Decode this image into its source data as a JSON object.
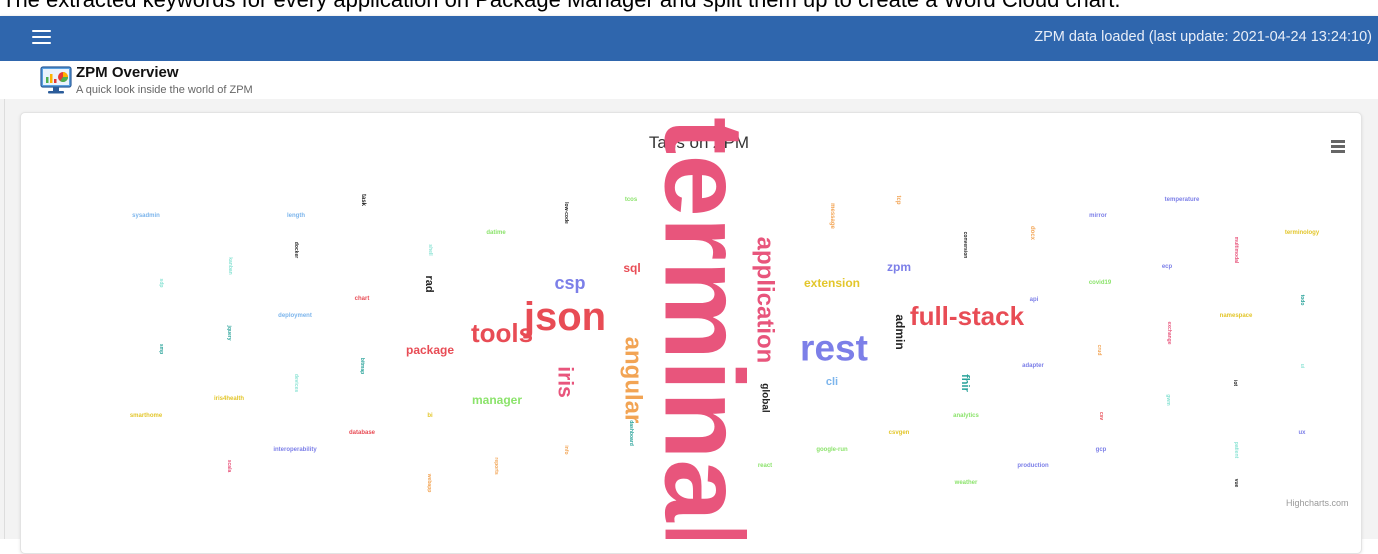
{
  "caption": "The extracted keywords for every application on Package Manager and split them up to create a Word Cloud chart.",
  "header": {
    "status": "ZPM data loaded (last update: 2021-04-24 13:24:10)"
  },
  "page": {
    "title": "ZPM Overview",
    "subtitle": "A quick look inside the world of ZPM"
  },
  "chart_data": {
    "type": "wordcloud",
    "title": "Tags on ZPM",
    "credits": "Highcharts.com",
    "words": [
      {
        "text": "terminal",
        "color": "#e8557c"
      },
      {
        "text": "json",
        "color": "#e84c55"
      },
      {
        "text": "rest",
        "color": "#7c7fe8"
      },
      {
        "text": "application",
        "color": "#e8557c"
      },
      {
        "text": "full-stack",
        "color": "#e84c55"
      },
      {
        "text": "angular",
        "color": "#f2a454"
      },
      {
        "text": "tools",
        "color": "#e84c55"
      },
      {
        "text": "iris",
        "color": "#e8557c"
      },
      {
        "text": "csp",
        "color": "#7c7fe8"
      },
      {
        "text": "extension",
        "color": "#e3c62b"
      },
      {
        "text": "sql",
        "color": "#e84c55"
      },
      {
        "text": "manager",
        "color": "#8be36b"
      },
      {
        "text": "package",
        "color": "#e84c55"
      },
      {
        "text": "zpm",
        "color": "#7c7fe8"
      },
      {
        "text": "admin",
        "color": "#222222"
      },
      {
        "text": "global",
        "color": "#222222"
      },
      {
        "text": "fhir",
        "color": "#2aa39a"
      },
      {
        "text": "rad",
        "color": "#222222"
      },
      {
        "text": "cli",
        "color": "#7cb5ec"
      },
      {
        "text": "sysadmin",
        "color": "#7cb5ec"
      },
      {
        "text": "length",
        "color": "#7cb5ec"
      },
      {
        "text": "task",
        "color": "#222222"
      },
      {
        "text": "low-code",
        "color": "#222222"
      },
      {
        "text": "tcos",
        "color": "#8be36b"
      },
      {
        "text": "datime",
        "color": "#8be36b"
      },
      {
        "text": "message",
        "color": "#f2a454"
      },
      {
        "text": "tcp",
        "color": "#f2a454"
      },
      {
        "text": "conversion",
        "color": "#222222"
      },
      {
        "text": "temperature",
        "color": "#7c7fe8"
      },
      {
        "text": "mirror",
        "color": "#7c7fe8"
      },
      {
        "text": "terminology",
        "color": "#e3c62b"
      },
      {
        "text": "docker",
        "color": "#222222"
      },
      {
        "text": "shell",
        "color": "#8be3d4"
      },
      {
        "text": "kanban",
        "color": "#8be3d4"
      },
      {
        "text": "sdp",
        "color": "#8be3d4"
      },
      {
        "text": "chart",
        "color": "#e84c55"
      },
      {
        "text": "deployment",
        "color": "#7cb5ec"
      },
      {
        "text": "jquery",
        "color": "#2aa39a"
      },
      {
        "text": "smp",
        "color": "#2aa39a"
      },
      {
        "text": "bitmap",
        "color": "#2aa39a"
      },
      {
        "text": "devices",
        "color": "#8be3d4"
      },
      {
        "text": "iris4health",
        "color": "#e3c62b"
      },
      {
        "text": "smarthome",
        "color": "#e3c62b"
      },
      {
        "text": "bi",
        "color": "#e3c62b"
      },
      {
        "text": "database",
        "color": "#e84c55"
      },
      {
        "text": "interoperability",
        "color": "#7c7fe8"
      },
      {
        "text": "scala",
        "color": "#e8557c"
      },
      {
        "text": "webapp",
        "color": "#f2a454"
      },
      {
        "text": "reports",
        "color": "#f2a454"
      },
      {
        "text": "info",
        "color": "#f2a454"
      },
      {
        "text": "dashboard",
        "color": "#2aa39a"
      },
      {
        "text": "docx",
        "color": "#f2a454"
      },
      {
        "text": "multimodal",
        "color": "#e8557c"
      },
      {
        "text": "ecp",
        "color": "#7c7fe8"
      },
      {
        "text": "covid19",
        "color": "#8be36b"
      },
      {
        "text": "api",
        "color": "#7c7fe8"
      },
      {
        "text": "namespace",
        "color": "#e3c62b"
      },
      {
        "text": "todo",
        "color": "#2aa39a"
      },
      {
        "text": "exchange",
        "color": "#e8557c"
      },
      {
        "text": "crud",
        "color": "#f2a454"
      },
      {
        "text": "adapter",
        "color": "#7c7fe8"
      },
      {
        "text": "ui",
        "color": "#8be3d4"
      },
      {
        "text": "iot",
        "color": "#222222"
      },
      {
        "text": "gwm",
        "color": "#8be3d4"
      },
      {
        "text": "analytics",
        "color": "#8be36b"
      },
      {
        "text": "csv",
        "color": "#e84c55"
      },
      {
        "text": "ux",
        "color": "#7c7fe8"
      },
      {
        "text": "csvgen",
        "color": "#e3c62b"
      },
      {
        "text": "google-run",
        "color": "#8be36b"
      },
      {
        "text": "gcp",
        "color": "#7c7fe8"
      },
      {
        "text": "patient",
        "color": "#8be3d4"
      },
      {
        "text": "react",
        "color": "#8be36b"
      },
      {
        "text": "production",
        "color": "#7c7fe8"
      },
      {
        "text": "weather",
        "color": "#8be36b"
      },
      {
        "text": "vue",
        "color": "#222222"
      }
    ]
  }
}
